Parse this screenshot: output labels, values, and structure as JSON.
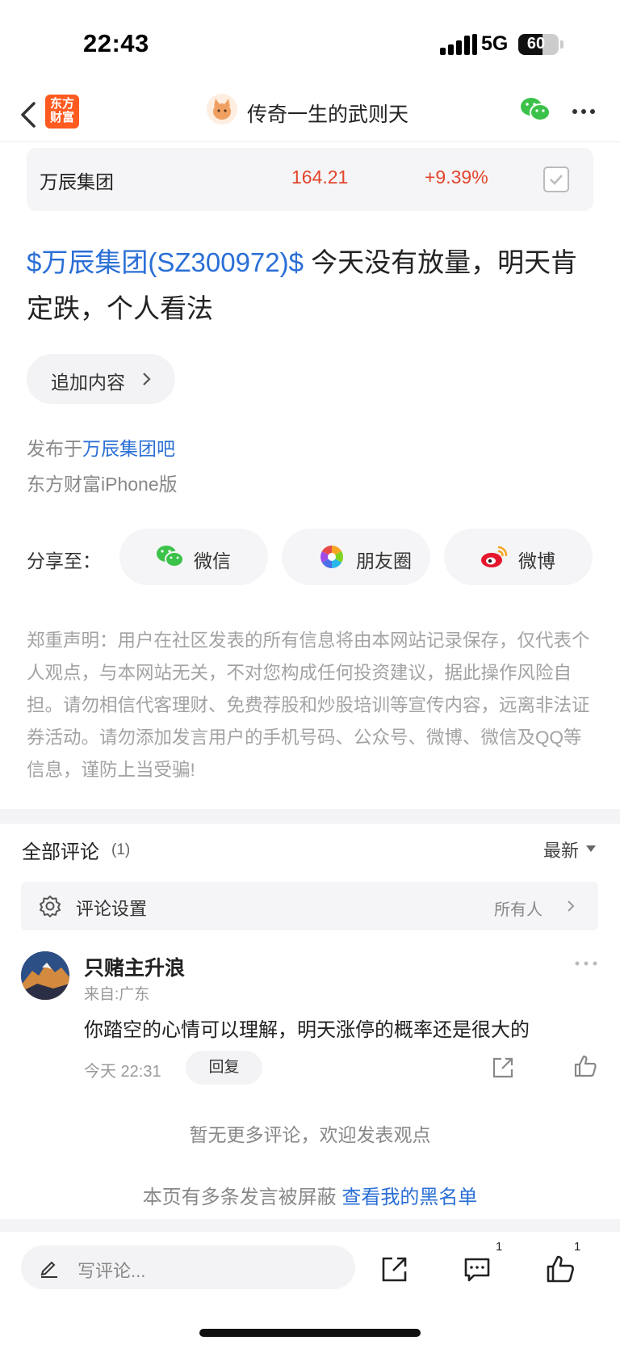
{
  "status_bar": {
    "time": "22:43",
    "network": "5G",
    "battery": "60",
    "battery_level_pct": 60
  },
  "nav": {
    "app_logo_line1": "东方",
    "app_logo_line2": "财富",
    "title": "传奇一生的武则天"
  },
  "stock": {
    "name": "万辰集团",
    "price": "164.21",
    "change": "+9.39%"
  },
  "post": {
    "tag": "$万辰集团(SZ300972)$",
    "text": " 今天没有放量，明天肯定跌，个人看法",
    "append_label": "追加内容",
    "publish_prefix": "发布于",
    "publish_bar": "万辰集团吧",
    "client": "东方财富iPhone版"
  },
  "share": {
    "label": "分享至：",
    "wechat": "微信",
    "moments": "朋友圈",
    "weibo": "微博"
  },
  "disclaimer": "郑重声明：用户在社区发表的所有信息将由本网站记录保存，仅代表个人观点，与本网站无关，不对您构成任何投资建议，据此操作风险自担。请勿相信代客理财、免费荐股和炒股培训等宣传内容，远离非法证券活动。请勿添加发言用户的手机号码、公众号、微博、微信及QQ等信息，谨防上当受骗!",
  "comments": {
    "title": "全部评论",
    "count": "(1)",
    "sort": "最新",
    "settings_label": "评论设置",
    "settings_value": "所有人",
    "items": [
      {
        "name": "只赌主升浪",
        "location": "来自:广东",
        "text": "你踏空的心情可以理解，明天涨停的概率还是很大的",
        "time": "今天 22:31",
        "reply": "回复"
      }
    ],
    "no_more": "暂无更多评论，欢迎发表观点",
    "blocked_text": "本页有多条发言被屏蔽 ",
    "blocked_link": "查看我的黑名单"
  },
  "bottom_bar": {
    "write_placeholder": "写评论...",
    "comment_badge": "1",
    "like_badge": "1"
  },
  "colors": {
    "accent_blue": "#2a6fd6",
    "price_red": "#e2452b",
    "brand_orange": "#ff5a1f"
  }
}
